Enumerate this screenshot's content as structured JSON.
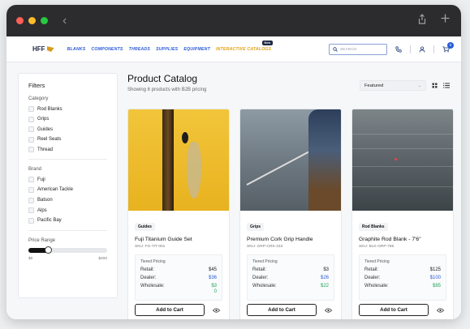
{
  "browser": {
    "back_icon": "chevron-left-icon",
    "share_icon": "share-icon",
    "new_tab_icon": "plus-icon"
  },
  "header": {
    "logo": "HFF",
    "nav": [
      "BLANKS",
      "COMPONENTS",
      "THREADS",
      "SUPPLIES",
      "EQUIPMENT",
      "INTERACTIVE CATALOGS"
    ],
    "nav_badge": "New",
    "search_placeholder": "SEARCH",
    "cart_count": "0",
    "colors": {
      "nav": "#2a5bd7",
      "accent": "#e0a113"
    }
  },
  "filters": {
    "title": "Filters",
    "category_title": "Category",
    "categories": [
      "Rod Blanks",
      "Grips",
      "Guides",
      "Reel Seats",
      "Thread"
    ],
    "brand_title": "Brand",
    "brands": [
      "Fuji",
      "American Tackle",
      "Batson",
      "Alps",
      "Pacific Bay"
    ],
    "price_title": "Price Range",
    "price_min": "$0",
    "price_max": "$200",
    "price_selected_fraction": 0.25
  },
  "catalog": {
    "title": "Product Catalog",
    "subtitle": "Showing 6 products with B2B pricing",
    "sort_value": "Featured",
    "add_label": "Add to Cart",
    "tiered_label": "Tiered Pricing",
    "retail_label": "Retail:",
    "dealer_label": "Dealer:",
    "wholesale_label": "Wholesale:",
    "products": [
      {
        "tag": "Guides",
        "name": "Fuji Titanium Guide Set",
        "sku": "SKU: FG-TIT-001",
        "retail": "$45",
        "dealer": "$36",
        "wholesale": "$3\n0"
      },
      {
        "tag": "Grips",
        "name": "Premium Cork Grip Handle",
        "sku": "SKU: GRP-CRK-234",
        "retail": "$3",
        "dealer": "$26",
        "wholesale": "$22"
      },
      {
        "tag": "Rod Blanks",
        "name": "Graphite Rod Blank - 7'6\"",
        "sku": "SKU: BLK-GRP-765",
        "retail": "$125",
        "dealer": "$100",
        "wholesale": "$85"
      }
    ]
  }
}
